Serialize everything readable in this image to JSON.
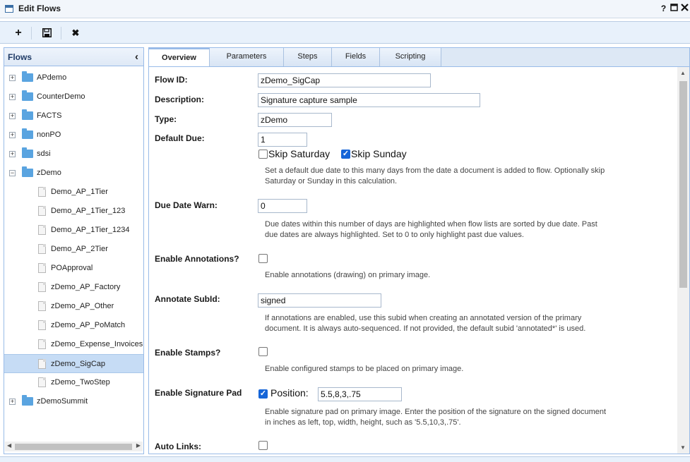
{
  "window": {
    "title": "Edit Flows",
    "help_label": "?",
    "maximize_icon": "maximize-icon",
    "close_icon": "close-icon"
  },
  "toolbar": {
    "add_label": "+",
    "save_icon": "save-icon",
    "delete_label": "✖"
  },
  "left": {
    "title": "Flows",
    "collapse_label": "‹",
    "tree": [
      {
        "label": "APdemo",
        "type": "folder",
        "expanded": false
      },
      {
        "label": "CounterDemo",
        "type": "folder",
        "expanded": false
      },
      {
        "label": "FACTS",
        "type": "folder",
        "expanded": false
      },
      {
        "label": "nonPO",
        "type": "folder",
        "expanded": false
      },
      {
        "label": "sdsi",
        "type": "folder",
        "expanded": false
      },
      {
        "label": "zDemo",
        "type": "folder",
        "expanded": true
      },
      {
        "label": "Demo_AP_1Tier",
        "type": "doc"
      },
      {
        "label": "Demo_AP_1Tier_123",
        "type": "doc"
      },
      {
        "label": "Demo_AP_1Tier_1234",
        "type": "doc"
      },
      {
        "label": "Demo_AP_2Tier",
        "type": "doc"
      },
      {
        "label": "POApproval",
        "type": "doc"
      },
      {
        "label": "zDemo_AP_Factory",
        "type": "doc"
      },
      {
        "label": "zDemo_AP_Other",
        "type": "doc"
      },
      {
        "label": "zDemo_AP_PoMatch",
        "type": "doc"
      },
      {
        "label": "zDemo_Expense_Invoices",
        "type": "doc"
      },
      {
        "label": "zDemo_SigCap",
        "type": "doc",
        "selected": true
      },
      {
        "label": "zDemo_TwoStep",
        "type": "doc"
      },
      {
        "label": "zDemoSummit",
        "type": "folder",
        "expanded": false
      }
    ]
  },
  "tabs": [
    "Overview",
    "Parameters",
    "Steps",
    "Fields",
    "Scripting"
  ],
  "active_tab": "Overview",
  "form": {
    "flow_id": {
      "label": "Flow ID:",
      "value": "zDemo_SigCap"
    },
    "description": {
      "label": "Description:",
      "value": "Signature capture sample"
    },
    "type": {
      "label": "Type:",
      "value": "zDemo"
    },
    "default_due": {
      "label": "Default Due:",
      "value": "1",
      "skip_saturday_label": "Skip Saturday",
      "skip_saturday_checked": false,
      "skip_sunday_label": "Skip Sunday",
      "skip_sunday_checked": true,
      "help_line1": "Set a default due date to this many days from the date a document is added to flow. Optionally skip",
      "help_line2": "Saturday or Sunday in this calculation."
    },
    "due_date_warn": {
      "label": "Due Date Warn:",
      "value": "0",
      "help_line1": "Due dates within this number of days are highlighted when flow lists are sorted by due date. Past",
      "help_line2": "due dates are always highlighted. Set to 0 to only highlight past due values."
    },
    "enable_annotations": {
      "label": "Enable Annotations?",
      "checked": false,
      "help": "Enable annotations (drawing) on primary image."
    },
    "annotate_subid": {
      "label": "Annotate SubId:",
      "value": "signed",
      "help_line1": "If annotations are enabled, use this subid when creating an annotated version of the primary",
      "help_line2": "document. It is always auto-sequenced. If not provided, the default subid 'annotated*' is used."
    },
    "enable_stamps": {
      "label": "Enable Stamps?",
      "checked": false,
      "help": "Enable configured stamps to be placed on primary image."
    },
    "enable_signature_pad": {
      "label": "Enable Signature Pad",
      "checked": true,
      "position_label": "Position:",
      "position_value": "5.5,8,3,.75",
      "help_line1": "Enable signature pad on primary image. Enter the position of the signature on the signed document",
      "help_line2": "in inches as left, top, width, height, such as '5.5,10,3,.75'."
    },
    "auto_links": {
      "label": "Auto Links:",
      "checked": false
    }
  }
}
